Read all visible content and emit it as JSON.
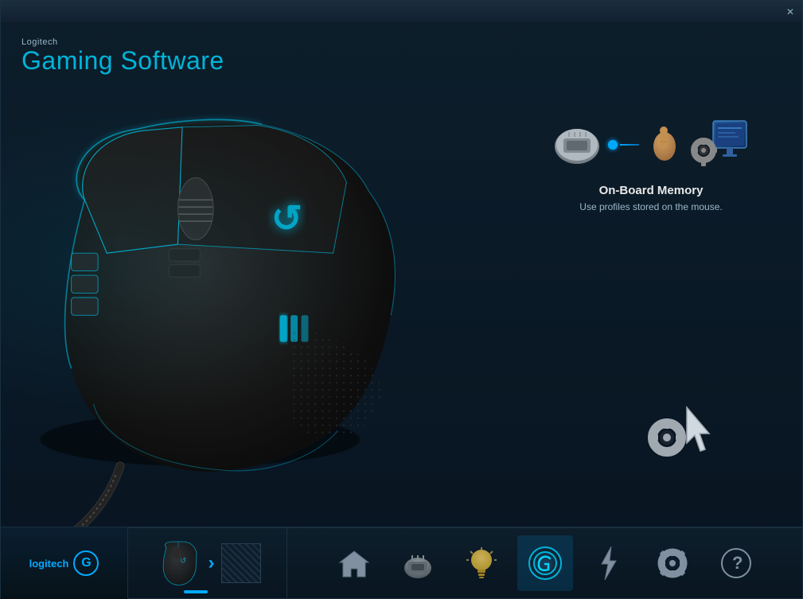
{
  "window": {
    "close_label": "✕"
  },
  "header": {
    "brand": "Logitech",
    "title": "Gaming Software"
  },
  "onboard_memory": {
    "title": "On-Board Memory",
    "description": "Use profiles stored on the mouse."
  },
  "toolbar": {
    "logo_text": "logitech",
    "logo_g": "G",
    "device_arrow": "›",
    "nav_items": [
      {
        "id": "home",
        "icon": "🏠",
        "label": "Home",
        "active": false
      },
      {
        "id": "memory",
        "icon": "💾",
        "label": "Memory",
        "active": false
      },
      {
        "id": "lighting",
        "icon": "💡",
        "label": "Lighting",
        "active": false
      },
      {
        "id": "onboard",
        "icon": "🖱️",
        "label": "On-board",
        "active": true
      },
      {
        "id": "power",
        "icon": "⚡",
        "label": "Power",
        "active": false
      },
      {
        "id": "settings",
        "icon": "⚙️",
        "label": "Settings",
        "active": false
      },
      {
        "id": "help",
        "icon": "?",
        "label": "Help",
        "active": false
      }
    ]
  }
}
